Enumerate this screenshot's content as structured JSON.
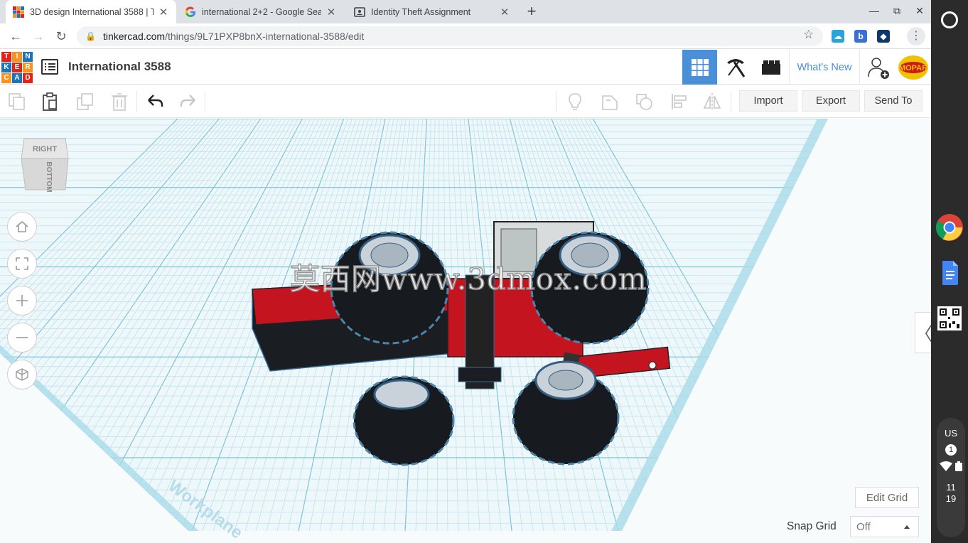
{
  "browser": {
    "tabs": [
      {
        "title": "3D design International 3588 | T",
        "active": true
      },
      {
        "title": "international 2+2 - Google Searc",
        "active": false
      },
      {
        "title": "Identity Theft Assignment",
        "active": false
      }
    ],
    "url_host": "tinkercad.com",
    "url_path": "/things/9L71PXP8bnX-international-3588/edit"
  },
  "app": {
    "logo_letters": [
      "T",
      "I",
      "N",
      "K",
      "E",
      "R",
      "C",
      "A",
      "D"
    ],
    "logo_colors": [
      "#e2231a",
      "#f7941d",
      "#1b75bc",
      "#1b75bc",
      "#e2231a",
      "#f7941d",
      "#f7941d",
      "#1b75bc",
      "#e2231a"
    ],
    "design_title": "International 3588",
    "whats_new": "What's New",
    "accent": "#4a90d9"
  },
  "toolbar": {
    "import_label": "Import",
    "export_label": "Export",
    "send_to_label": "Send To"
  },
  "viewcube": {
    "top_face": "RIGHT",
    "front_face": "BOTTOM"
  },
  "workplane": {
    "label": "Workplane"
  },
  "watermark": "莫西网www.3dmox.com",
  "edit_grid_label": "Edit Grid",
  "snap_grid": {
    "label": "Snap Grid",
    "value": "Off"
  },
  "shelf": {
    "status": {
      "locale": "US",
      "notifications": "1",
      "time_hour": "11",
      "time_minute": "19"
    }
  }
}
